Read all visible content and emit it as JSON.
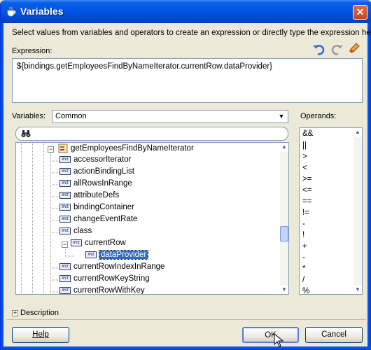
{
  "window": {
    "title": "Variables",
    "close_glyph": "✕"
  },
  "instruction": "Select values from variables and operators to create an expression or directly type the expression here:",
  "expression": {
    "label": "Expression:",
    "value": "${bindings.getEmployeesFindByNameIterator.currentRow.dataProvider}"
  },
  "toolbar": {
    "icons": [
      "undo-icon",
      "redo-icon",
      "clear-icon"
    ]
  },
  "variables": {
    "label": "Variables:",
    "selected": "Common"
  },
  "tree": {
    "items": [
      {
        "label": "getEmployeesFindByNameIterator",
        "expanded": true
      },
      {
        "label": "accessorIterator"
      },
      {
        "label": "actionBindingList"
      },
      {
        "label": "allRowsInRange"
      },
      {
        "label": "attributeDefs"
      },
      {
        "label": "bindingContainer"
      },
      {
        "label": "changeEventRate"
      },
      {
        "label": "class"
      },
      {
        "label": "currentRow",
        "expanded": true
      },
      {
        "label": "dataProvider",
        "selected": true
      },
      {
        "label": "currentRowIndexInRange"
      },
      {
        "label": "currentRowKeyString"
      },
      {
        "label": "currentRowWithKey"
      }
    ],
    "icon_text": "XYZ"
  },
  "operands": {
    "label": "Operands:",
    "items": [
      "&&",
      "||",
      ">",
      "<",
      ">=",
      "<=",
      "==",
      "!=",
      "-",
      "!",
      "+",
      "-",
      "*",
      "/",
      "%"
    ]
  },
  "description": {
    "label": "Description"
  },
  "buttons": {
    "help": "Help",
    "ok": "OK",
    "cancel": "Cancel"
  }
}
